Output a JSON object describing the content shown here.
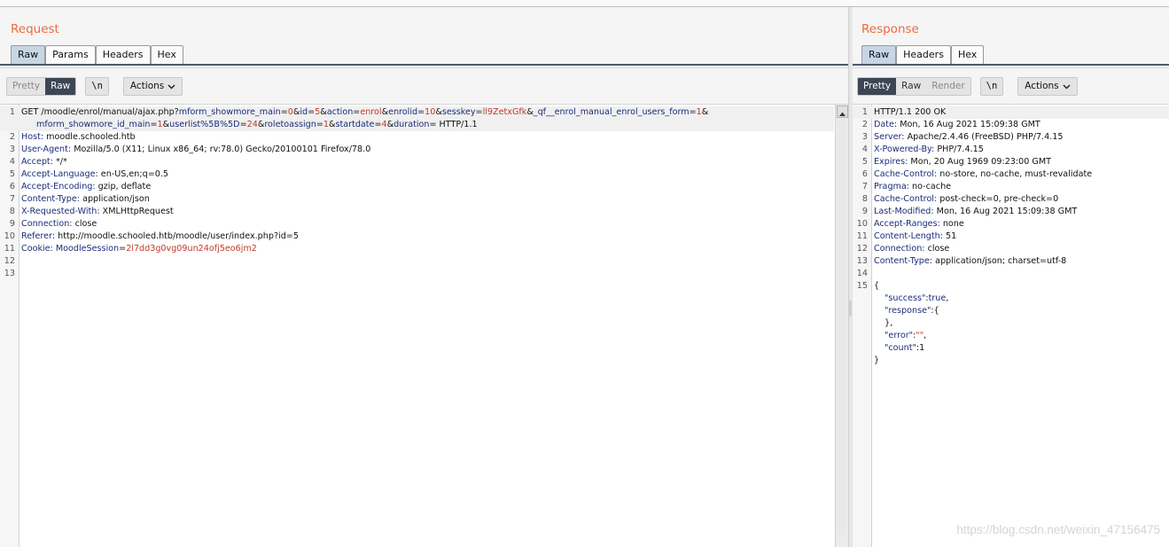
{
  "request": {
    "title": "Request",
    "tabs": [
      "Raw",
      "Params",
      "Headers",
      "Hex"
    ],
    "active_tab": "Raw",
    "toolbar": {
      "pretty": "Pretty",
      "raw": "Raw",
      "newline": "\\n",
      "actions": "Actions"
    },
    "lines": [
      {
        "n": "1",
        "parts": [
          {
            "t": "GET /moodle/enrol/manual/ajax.php?",
            "c": ""
          },
          {
            "t": "mform_showmore_main",
            "c": "k"
          },
          {
            "t": "=",
            "c": ""
          },
          {
            "t": "0",
            "c": "v"
          },
          {
            "t": "&",
            "c": ""
          },
          {
            "t": "id",
            "c": "k"
          },
          {
            "t": "=",
            "c": ""
          },
          {
            "t": "5",
            "c": "v"
          },
          {
            "t": "&",
            "c": ""
          },
          {
            "t": "action",
            "c": "k"
          },
          {
            "t": "=",
            "c": ""
          },
          {
            "t": "enrol",
            "c": "v"
          },
          {
            "t": "&",
            "c": ""
          },
          {
            "t": "enrolid",
            "c": "k"
          },
          {
            "t": "=",
            "c": ""
          },
          {
            "t": "10",
            "c": "v"
          },
          {
            "t": "&",
            "c": ""
          },
          {
            "t": "sesskey",
            "c": "k"
          },
          {
            "t": "=",
            "c": ""
          },
          {
            "t": "ll9ZetxGfk",
            "c": "v"
          },
          {
            "t": "&",
            "c": ""
          },
          {
            "t": "_qf__enrol_manual_enrol_users_form",
            "c": "k"
          },
          {
            "t": "=",
            "c": ""
          },
          {
            "t": "1",
            "c": "v"
          },
          {
            "t": "&",
            "c": ""
          }
        ]
      },
      {
        "n": "",
        "wrap": true,
        "parts": [
          {
            "t": "mform_showmore_id_main",
            "c": "k"
          },
          {
            "t": "=",
            "c": ""
          },
          {
            "t": "1",
            "c": "v"
          },
          {
            "t": "&",
            "c": ""
          },
          {
            "t": "userlist%5B%5D",
            "c": "k"
          },
          {
            "t": "=",
            "c": ""
          },
          {
            "t": "24",
            "c": "v"
          },
          {
            "t": "&",
            "c": ""
          },
          {
            "t": "roletoassign",
            "c": "k"
          },
          {
            "t": "=",
            "c": ""
          },
          {
            "t": "1",
            "c": "v"
          },
          {
            "t": "&",
            "c": ""
          },
          {
            "t": "startdate",
            "c": "k"
          },
          {
            "t": "=",
            "c": ""
          },
          {
            "t": "4",
            "c": "v"
          },
          {
            "t": "&",
            "c": ""
          },
          {
            "t": "duration",
            "c": "k"
          },
          {
            "t": "= HTTP/1.1",
            "c": ""
          }
        ]
      },
      {
        "n": "2",
        "parts": [
          {
            "t": "Host:",
            "c": "k"
          },
          {
            "t": " moodle.schooled.htb",
            "c": ""
          }
        ]
      },
      {
        "n": "3",
        "parts": [
          {
            "t": "User-Agent:",
            "c": "k"
          },
          {
            "t": " Mozilla/5.0 (X11; Linux x86_64; rv:78.0) Gecko/20100101 Firefox/78.0",
            "c": ""
          }
        ]
      },
      {
        "n": "4",
        "parts": [
          {
            "t": "Accept:",
            "c": "k"
          },
          {
            "t": " */*",
            "c": ""
          }
        ]
      },
      {
        "n": "5",
        "parts": [
          {
            "t": "Accept-Language:",
            "c": "k"
          },
          {
            "t": " en-US,en;q=0.5",
            "c": ""
          }
        ]
      },
      {
        "n": "6",
        "parts": [
          {
            "t": "Accept-Encoding:",
            "c": "k"
          },
          {
            "t": " gzip, deflate",
            "c": ""
          }
        ]
      },
      {
        "n": "7",
        "parts": [
          {
            "t": "Content-Type:",
            "c": "k"
          },
          {
            "t": " application/json",
            "c": ""
          }
        ]
      },
      {
        "n": "8",
        "parts": [
          {
            "t": "X-Requested-With:",
            "c": "k"
          },
          {
            "t": " XMLHttpRequest",
            "c": ""
          }
        ]
      },
      {
        "n": "9",
        "parts": [
          {
            "t": "Connection:",
            "c": "k"
          },
          {
            "t": " close",
            "c": ""
          }
        ]
      },
      {
        "n": "10",
        "parts": [
          {
            "t": "Referer:",
            "c": "k"
          },
          {
            "t": " http://moodle.schooled.htb/moodle/user/index.php?id=5",
            "c": ""
          }
        ]
      },
      {
        "n": "11",
        "parts": [
          {
            "t": "Cookie:",
            "c": "k"
          },
          {
            "t": " MoodleSession",
            "c": "k"
          },
          {
            "t": "=",
            "c": ""
          },
          {
            "t": "2l7dd3g0vg09un24ofj5eo6jm2",
            "c": "v"
          }
        ]
      },
      {
        "n": "12",
        "parts": []
      },
      {
        "n": "13",
        "parts": []
      }
    ]
  },
  "response": {
    "title": "Response",
    "tabs": [
      "Raw",
      "Headers",
      "Hex"
    ],
    "active_tab": "Raw",
    "toolbar": {
      "pretty": "Pretty",
      "raw": "Raw",
      "render": "Render",
      "newline": "\\n",
      "actions": "Actions"
    },
    "lines": [
      {
        "n": "1",
        "parts": [
          {
            "t": "HTTP/1.1 200 OK",
            "c": ""
          }
        ]
      },
      {
        "n": "2",
        "parts": [
          {
            "t": "Date:",
            "c": "k"
          },
          {
            "t": " Mon, 16 Aug 2021 15:09:38 GMT",
            "c": ""
          }
        ]
      },
      {
        "n": "3",
        "parts": [
          {
            "t": "Server:",
            "c": "k"
          },
          {
            "t": " Apache/2.4.46 (FreeBSD) PHP/7.4.15",
            "c": ""
          }
        ]
      },
      {
        "n": "4",
        "parts": [
          {
            "t": "X-Powered-By:",
            "c": "k"
          },
          {
            "t": " PHP/7.4.15",
            "c": ""
          }
        ]
      },
      {
        "n": "5",
        "parts": [
          {
            "t": "Expires:",
            "c": "k"
          },
          {
            "t": " Mon, 20 Aug 1969 09:23:00 GMT",
            "c": ""
          }
        ]
      },
      {
        "n": "6",
        "parts": [
          {
            "t": "Cache-Control:",
            "c": "k"
          },
          {
            "t": " no-store, no-cache, must-revalidate",
            "c": ""
          }
        ]
      },
      {
        "n": "7",
        "parts": [
          {
            "t": "Pragma:",
            "c": "k"
          },
          {
            "t": " no-cache",
            "c": ""
          }
        ]
      },
      {
        "n": "8",
        "parts": [
          {
            "t": "Cache-Control:",
            "c": "k"
          },
          {
            "t": " post-check=0, pre-check=0",
            "c": ""
          }
        ]
      },
      {
        "n": "9",
        "parts": [
          {
            "t": "Last-Modified:",
            "c": "k"
          },
          {
            "t": " Mon, 16 Aug 2021 15:09:38 GMT",
            "c": ""
          }
        ]
      },
      {
        "n": "10",
        "parts": [
          {
            "t": "Accept-Ranges:",
            "c": "k"
          },
          {
            "t": " none",
            "c": ""
          }
        ]
      },
      {
        "n": "11",
        "parts": [
          {
            "t": "Content-Length:",
            "c": "k"
          },
          {
            "t": " 51",
            "c": ""
          }
        ]
      },
      {
        "n": "12",
        "parts": [
          {
            "t": "Connection:",
            "c": "k"
          },
          {
            "t": " close",
            "c": ""
          }
        ]
      },
      {
        "n": "13",
        "parts": [
          {
            "t": "Content-Type:",
            "c": "k"
          },
          {
            "t": " application/json; charset=utf-8",
            "c": ""
          }
        ]
      },
      {
        "n": "14",
        "parts": []
      },
      {
        "n": "15",
        "parts": [
          {
            "t": "{",
            "c": ""
          }
        ]
      },
      {
        "n": "",
        "indent": true,
        "parts": [
          {
            "t": "\"success\"",
            "c": "k"
          },
          {
            "t": ":",
            "c": ""
          },
          {
            "t": "true",
            "c": "k"
          },
          {
            "t": ",",
            "c": ""
          }
        ]
      },
      {
        "n": "",
        "indent": true,
        "parts": [
          {
            "t": "\"response\"",
            "c": "k"
          },
          {
            "t": ":{",
            "c": ""
          }
        ]
      },
      {
        "n": "",
        "indent": true,
        "parts": [
          {
            "t": "},",
            "c": ""
          }
        ]
      },
      {
        "n": "",
        "indent": true,
        "parts": [
          {
            "t": "\"error\"",
            "c": "k"
          },
          {
            "t": ":",
            "c": ""
          },
          {
            "t": "\"\"",
            "c": "v"
          },
          {
            "t": ",",
            "c": ""
          }
        ]
      },
      {
        "n": "",
        "indent": true,
        "parts": [
          {
            "t": "\"count\"",
            "c": "k"
          },
          {
            "t": ":",
            "c": ""
          },
          {
            "t": "1",
            "c": ""
          }
        ]
      },
      {
        "n": "",
        "parts": [
          {
            "t": "}",
            "c": ""
          }
        ]
      }
    ]
  },
  "watermark": "https://blog.csdn.net/weixin_47156475"
}
